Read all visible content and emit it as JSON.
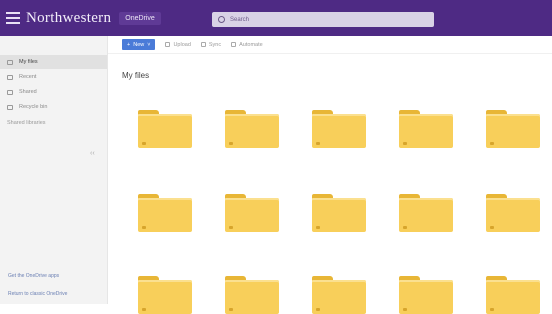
{
  "header": {
    "brand": "Northwestern",
    "app_name": "OneDrive",
    "search_placeholder": "Search"
  },
  "sidebar": {
    "items": [
      {
        "label": "My files",
        "icon": "folder-icon",
        "active": true
      },
      {
        "label": "Recent",
        "icon": "clock-icon",
        "active": false
      },
      {
        "label": "Shared",
        "icon": "share-icon",
        "active": false
      },
      {
        "label": "Recycle bin",
        "icon": "trash-icon",
        "active": false
      }
    ],
    "section_label": "Shared libraries",
    "footer_links": [
      "Get the OneDrive apps",
      "Return to classic OneDrive"
    ]
  },
  "commandbar": {
    "new_label": "New",
    "upload_label": "Upload",
    "sync_label": "Sync",
    "automate_label": "Automate"
  },
  "main": {
    "title": "My files",
    "folders": [
      {
        "name": ""
      },
      {
        "name": ""
      },
      {
        "name": ""
      },
      {
        "name": ""
      },
      {
        "name": ""
      },
      {
        "name": ""
      },
      {
        "name": ""
      },
      {
        "name": ""
      },
      {
        "name": ""
      },
      {
        "name": ""
      },
      {
        "name": ""
      },
      {
        "name": ""
      },
      {
        "name": ""
      },
      {
        "name": ""
      },
      {
        "name": ""
      }
    ]
  },
  "colors": {
    "header_bg": "#4e2a84",
    "accent": "#4a7bd8",
    "folder": "#f8cf5a"
  }
}
